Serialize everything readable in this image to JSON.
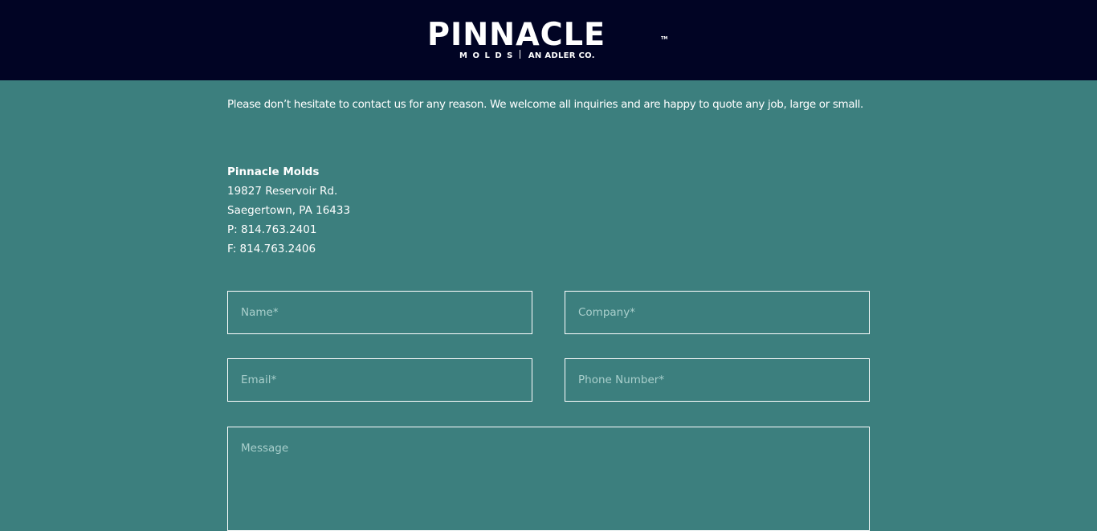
{
  "header": {
    "logo": {
      "name": "PINNACLE",
      "trademark": "TM",
      "sub_molds": "MOLDS",
      "sub_adler": "AN ADLER CO."
    },
    "background_color": "#010424"
  },
  "page": {
    "background_color": "#3c7f7e"
  },
  "intro": {
    "text": "Please don’t hesitate to contact us for any reason. We welcome all inquiries and are happy to quote any job, large or small."
  },
  "contact_info": {
    "company": "Pinnacle Molds",
    "street": "19827 Reservoir Rd.",
    "city_state_zip": "Saegertown, PA 16433",
    "phone": "P: 814.763.2401",
    "fax": "F: 814.763.2406"
  },
  "form": {
    "name": {
      "value": "",
      "placeholder": "Name*"
    },
    "company": {
      "value": "",
      "placeholder": "Company*"
    },
    "email": {
      "value": "",
      "placeholder": "Email*"
    },
    "phone": {
      "value": "",
      "placeholder": "Phone Number*"
    },
    "message": {
      "value": "",
      "placeholder": "Message"
    }
  }
}
